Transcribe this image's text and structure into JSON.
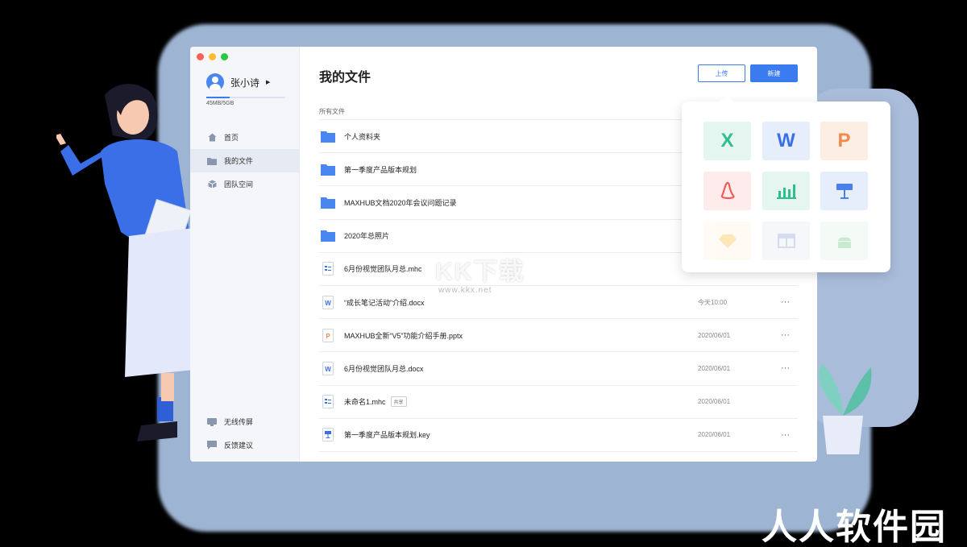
{
  "colors": {
    "accent": "#3a7bf0",
    "sidebar_bg": "#f4f6fa",
    "background": "#9db4d3"
  },
  "window_controls": [
    "#ff5f57",
    "#febc2e",
    "#28c840"
  ],
  "user": {
    "name": "张小诗",
    "quota_text": "45MB/5GB",
    "quota_fraction": 0.3
  },
  "sidebar": {
    "items": [
      {
        "label": "首页",
        "icon": "home-icon"
      },
      {
        "label": "我的文件",
        "icon": "folder-icon",
        "active": true
      },
      {
        "label": "团队空间",
        "icon": "cube-icon"
      }
    ],
    "bottom_items": [
      {
        "label": "无线传屏",
        "icon": "screen-cast-icon"
      },
      {
        "label": "反馈建议",
        "icon": "chat-icon"
      }
    ]
  },
  "main": {
    "title": "我的文件",
    "upload_label": "上传",
    "new_label": "新建",
    "all_files_label": "所有文件",
    "files": [
      {
        "name": "个人资料夹",
        "type": "folder",
        "date": "",
        "more": ""
      },
      {
        "name": "第一季度产品版本规划",
        "type": "folder",
        "date": "",
        "more": ""
      },
      {
        "name": "MAXHUB文档2020年会议问题记录",
        "type": "folder",
        "date": "",
        "more": ""
      },
      {
        "name": "2020年总照片",
        "type": "folder",
        "date": "",
        "more": ""
      },
      {
        "name": "6月份视觉团队月总.mhc",
        "type": "mhc",
        "date": "",
        "more": ""
      },
      {
        "name": "“成长笔记活动”介绍.docx",
        "type": "word",
        "date": "今天10:00",
        "more": "···"
      },
      {
        "name": "MAXHUB全新“V5”功能介绍手册.pptx",
        "type": "ppt",
        "date": "2020/06/01",
        "more": "···"
      },
      {
        "name": "6月份视觉团队月总.docx",
        "type": "word",
        "date": "2020/06/01",
        "more": "···"
      },
      {
        "name": "未命名1.mhc",
        "type": "mhc",
        "date": "2020/06/01",
        "more": "",
        "tag": "共享"
      },
      {
        "name": "第一季度产品版本规划.key",
        "type": "key",
        "date": "2020/06/01",
        "more": "···"
      }
    ]
  },
  "new_menu": {
    "tiles": [
      {
        "label": "X",
        "icon": "excel-icon"
      },
      {
        "label": "W",
        "icon": "word-icon"
      },
      {
        "label": "P",
        "icon": "powerpoint-icon"
      },
      {
        "label": "",
        "icon": "pdf-icon"
      },
      {
        "label": "",
        "icon": "chart-icon"
      },
      {
        "label": "",
        "icon": "keynote-icon"
      },
      {
        "label": "",
        "icon": "sketch-icon"
      },
      {
        "label": "",
        "icon": "layout-icon"
      },
      {
        "label": "",
        "icon": "android-icon"
      }
    ]
  },
  "watermark": {
    "logo": "KK下载",
    "url": "www.kkx.net",
    "corner": "人人软件园"
  }
}
